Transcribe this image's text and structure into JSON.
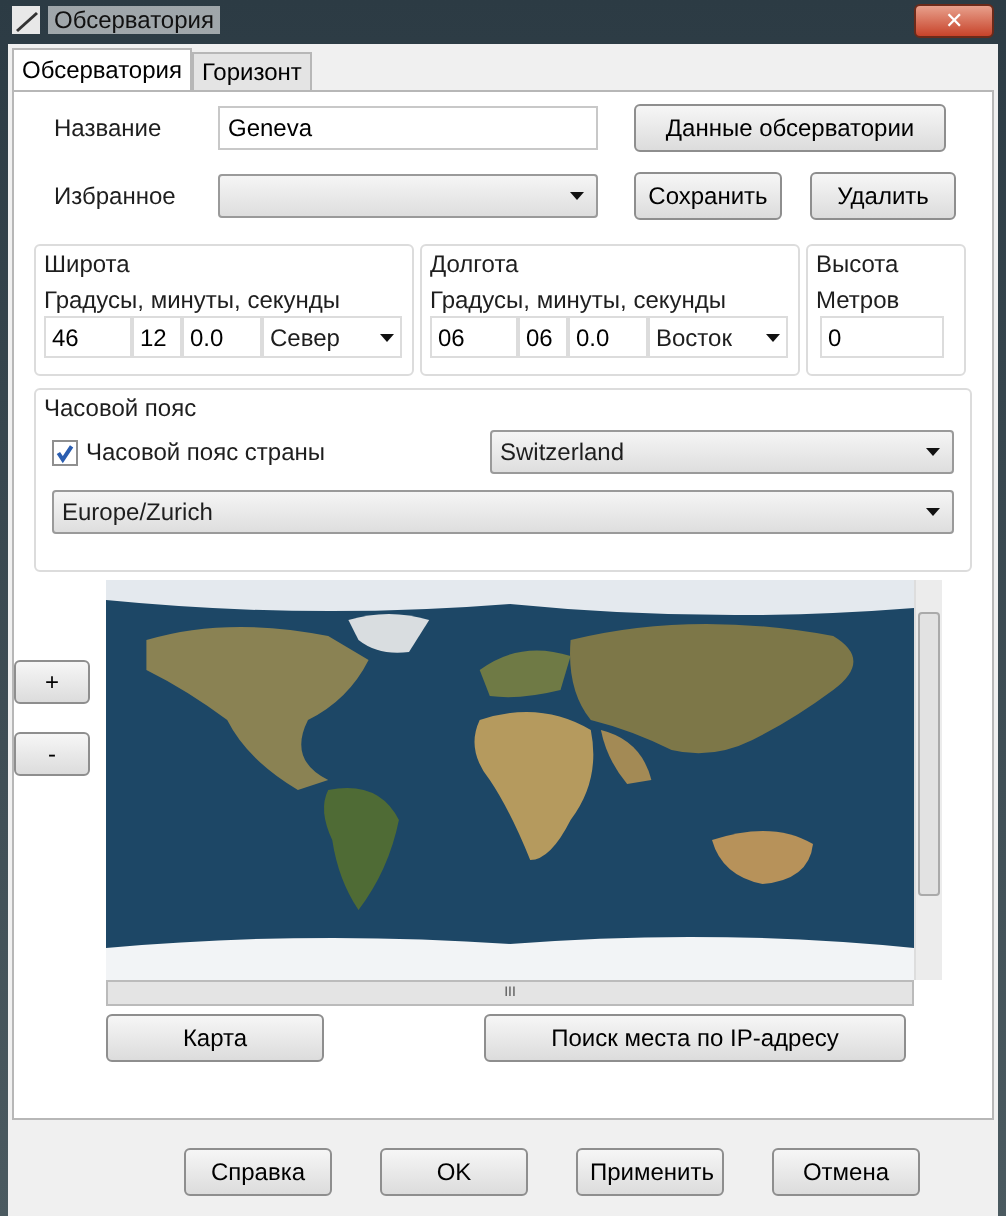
{
  "window": {
    "title": "Обсерватория",
    "close": "✕"
  },
  "tabs": [
    {
      "label": "Обсерватория",
      "selected": true
    },
    {
      "label": "Горизонт",
      "selected": false
    }
  ],
  "name": {
    "label": "Название",
    "value": "Geneva"
  },
  "observatory_data_button": "Данные обсерватории",
  "favorites": {
    "label": "Избранное"
  },
  "save_button": "Сохранить",
  "delete_button": "Удалить",
  "latitude": {
    "title": "Широта",
    "hint": "Градусы, минуты, секунды",
    "degrees": "46",
    "minutes": "12",
    "seconds": "0.0",
    "direction": "Север"
  },
  "longitude": {
    "title": "Долгота",
    "hint": "Градусы, минуты, секунды",
    "degrees": "06",
    "minutes": "06",
    "seconds": "0.0",
    "direction": "Восток"
  },
  "altitude": {
    "title": "Высота",
    "hint": "Метров",
    "value": "0"
  },
  "timezone": {
    "title": "Часовой пояс",
    "country_checkbox": {
      "label": "Часовой пояс страны",
      "checked": true
    },
    "country": "Switzerland",
    "zone": "Europe/Zurich"
  },
  "map": {
    "kind": "picture",
    "zoom_in": "+",
    "zoom_out": "-",
    "scroll_grip": "III"
  },
  "map_button": "Карта",
  "ip_search_button": "Поиск места по IP-адресу",
  "footer_buttons": [
    "Справка",
    "OK",
    "Применить",
    "Отмена"
  ]
}
